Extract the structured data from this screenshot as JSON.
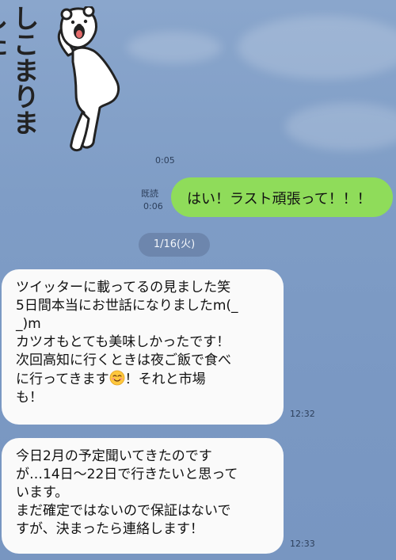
{
  "sticker": {
    "text": "しこまりました"
  },
  "messages": [
    {
      "id": "sticker-time",
      "time": "0:05"
    },
    {
      "id": "sent-1",
      "read": "既読",
      "time": "0:06",
      "text": "はい！ラスト頑張って！！！"
    },
    {
      "id": "date",
      "label": "1/16(火)"
    },
    {
      "id": "recv-1",
      "time": "12:32",
      "lines": [
        "ツイッターに載ってるの見ました笑",
        "5日間本当にお世話になりましたm(_",
        "_)m",
        "カツオもとても美味しかったです！",
        "次回高知に行くときは夜ご飯で食べ",
        "に行ってきます",
        "！それと市場",
        "も！"
      ]
    },
    {
      "id": "recv-2",
      "time": "12:33",
      "lines": [
        "今日2月の予定聞いてきたのです",
        "が…14日〜22日で行きたいと思って",
        "います。",
        "まだ確定ではないので保証はないで",
        "すが、決まったら連絡します！"
      ]
    }
  ],
  "colors": {
    "sent_bubble": "#8fdc5a",
    "received_bubble": "#fafafa",
    "background": "#7f9dc6",
    "date_pill": "#6d86ad"
  },
  "icons": [
    "bear-sticker",
    "smiling-face-emoji"
  ]
}
